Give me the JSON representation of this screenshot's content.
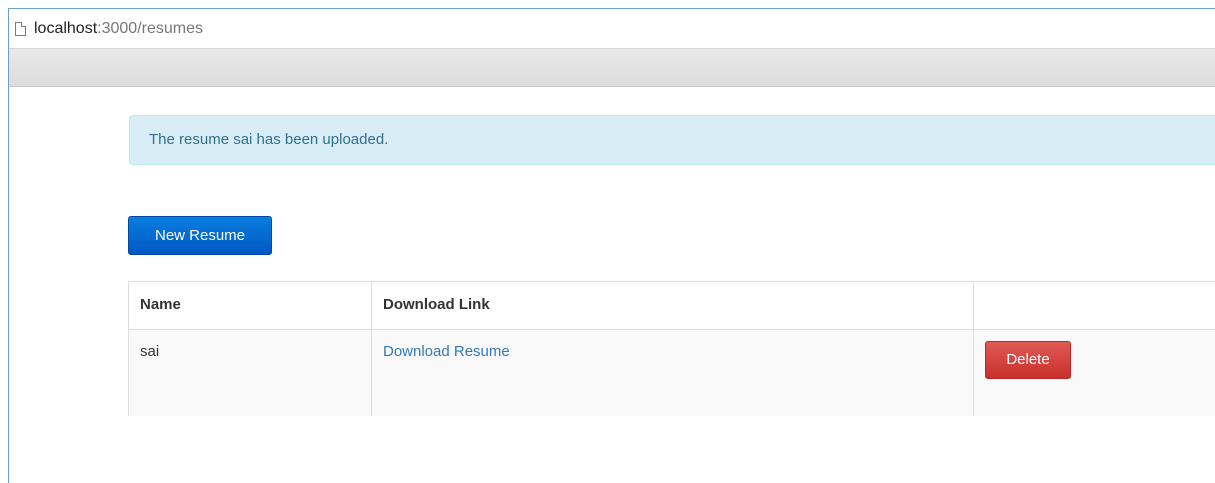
{
  "browser": {
    "url_host": "localhost",
    "url_rest": ":3000/resumes",
    "page_icon": "page-icon"
  },
  "alert": {
    "message": "The resume sai has been uploaded."
  },
  "actions": {
    "new_resume_label": "New Resume"
  },
  "table": {
    "headers": [
      "Name",
      "Download Link",
      ""
    ],
    "rows": [
      {
        "name": "sai",
        "download_label": "Download Resume",
        "delete_label": "Delete"
      }
    ]
  },
  "colors": {
    "alert_bg": "#d9edf7",
    "alert_text": "#31708f",
    "primary": "#0a6fd8",
    "danger": "#d9534f",
    "link": "#337ab7"
  }
}
